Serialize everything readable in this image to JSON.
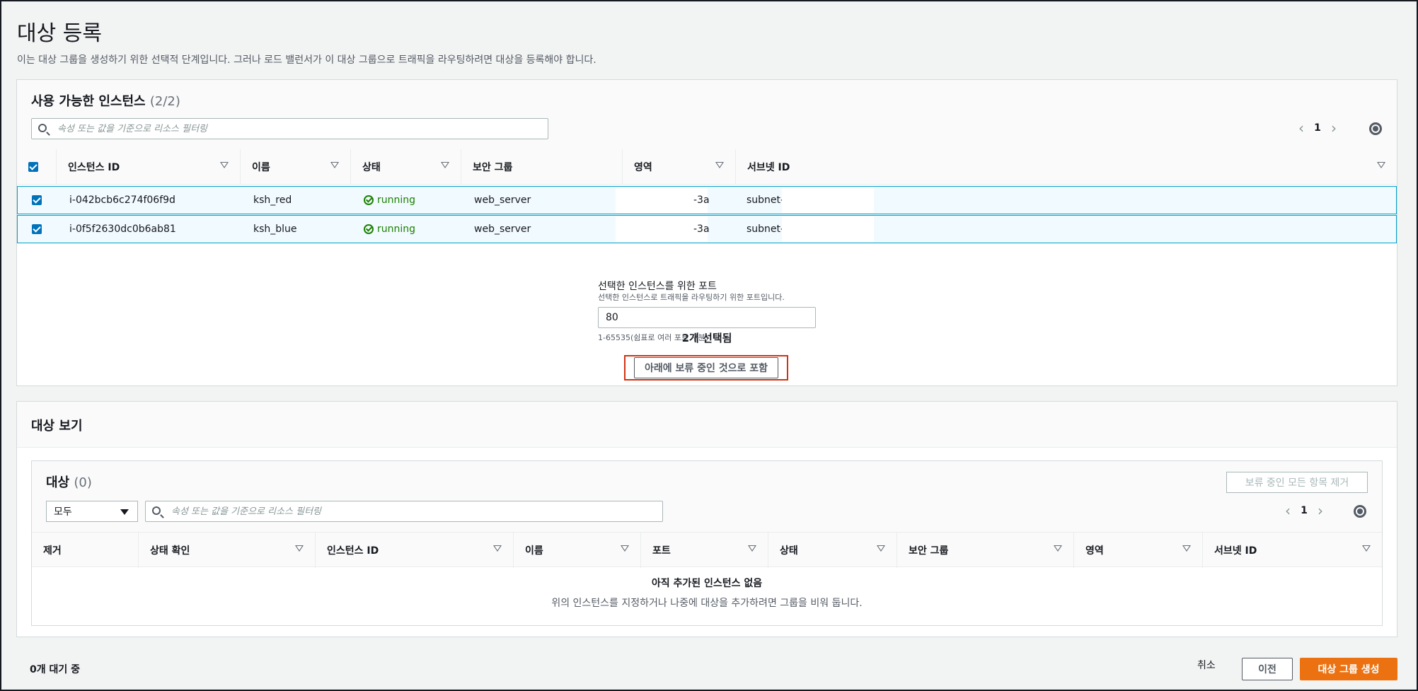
{
  "page": {
    "title": "대상 등록",
    "description": "이는 대상 그룹을 생성하기 위한 선택적 단계입니다. 그러나 로드 밸런서가 이 대상 그룹으로 트래픽을 라우팅하려면 대상을 등록해야 합니다."
  },
  "available": {
    "title": "사용 가능한 인스턴스",
    "count": "(2/2)",
    "search_placeholder": "속성 또는 값을 기준으로 리소스 필터링",
    "page": "1",
    "columns": [
      "인스턴스 ID",
      "이름",
      "상태",
      "보안 그룹",
      "영역",
      "서브넷 ID"
    ],
    "rows": [
      {
        "instance_id": "i-042bcb6c274f06f9d",
        "name": "ksh_red",
        "status": "running",
        "security_group": "web_server",
        "zone": "-3a",
        "subnet": "subnet-"
      },
      {
        "instance_id": "i-0f5f2630dc0b6ab81",
        "name": "ksh_blue",
        "status": "running",
        "security_group": "web_server",
        "zone": "-3a",
        "subnet": "subnet-"
      }
    ],
    "selected_text": "2개 선택됨",
    "port_label": "선택한 인스턴스를 위한 포트",
    "port_desc": "선택한 인스턴스로 트래픽을 라우팅하기 위한 포트입니다.",
    "port_value": "80",
    "port_hint": "1-65535(쉼표로 여러 포트 구분)",
    "include_button": "아래에 보류 중인 것으로 포함"
  },
  "review": {
    "title": "대상 보기",
    "targets_title": "대상",
    "targets_count": "(0)",
    "remove_all_button": "보류 중인 모든 항목 제거",
    "filter_select": "모두",
    "search_placeholder": "속성 또는 값을 기준으로 리소스 필터링",
    "page": "1",
    "columns": [
      "제거",
      "상태 확인",
      "인스턴스 ID",
      "이름",
      "포트",
      "상태",
      "보안 그룹",
      "영역",
      "서브넷 ID"
    ],
    "empty_title": "아직 추가된 인스턴스 없음",
    "empty_desc": "위의 인스턴스를 지정하거나 나중에 대상을 추가하려면 그룹을 비워 둡니다."
  },
  "footer": {
    "pending_count": "0개 대기 중",
    "cancel": "취소",
    "previous": "이전",
    "create": "대상 그룹 생성"
  },
  "colors": {
    "primary_button": "#ec7211",
    "selected_row_bg": "#f1faff",
    "selected_row_border": "#00a1c9",
    "status_running": "#1d8102",
    "highlight_box": "#d13212"
  }
}
